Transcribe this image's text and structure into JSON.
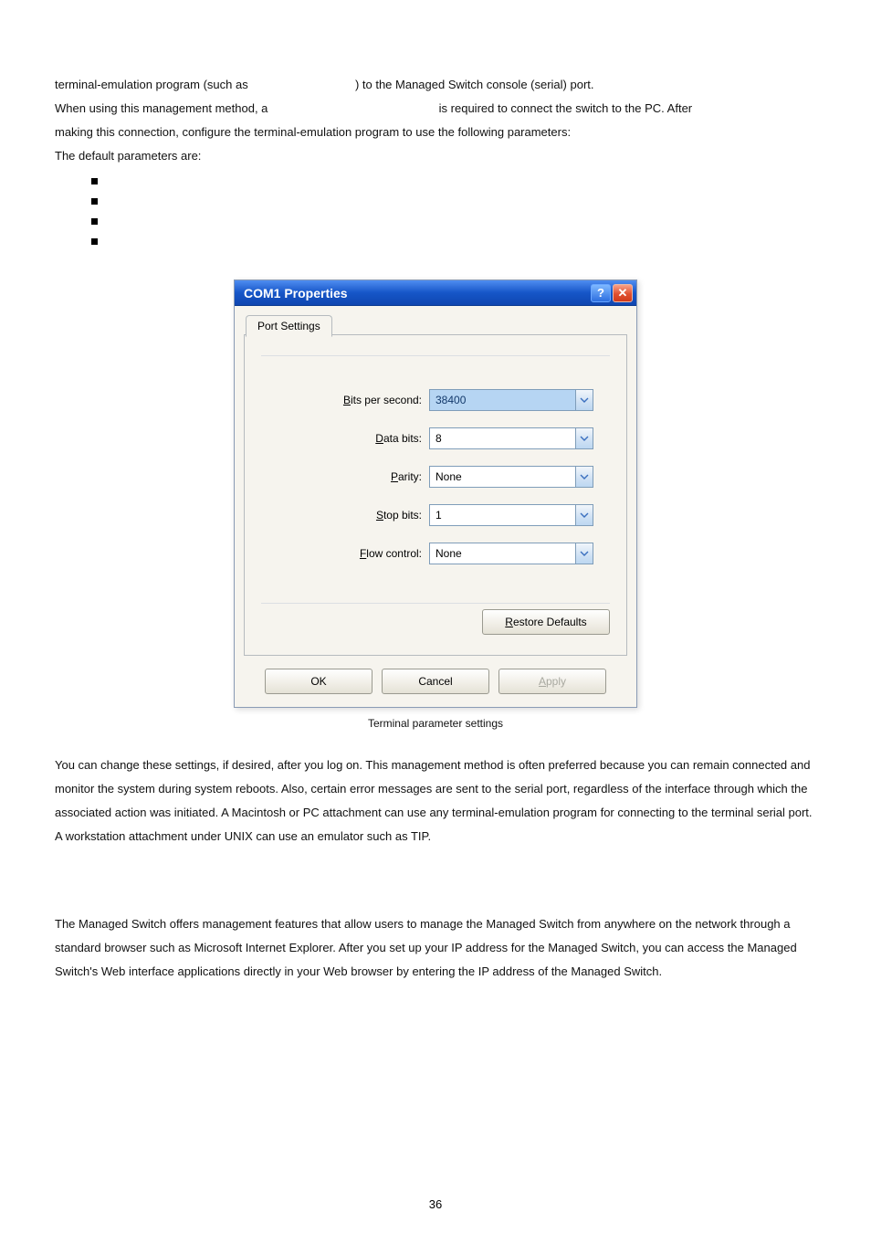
{
  "intro": {
    "line1_a": "terminal-emulation program (such as ",
    "line1_b": ") to the Managed Switch console (serial) port.",
    "line2_a": "When using this management method, a ",
    "line2_b": "is required to connect the switch to the PC. After",
    "line3": "making this connection, configure the terminal-emulation program to use the following parameters:",
    "line4": "The default parameters are:"
  },
  "dialog": {
    "title": "COM1 Properties",
    "help_symbol": "?",
    "close_symbol": "✕",
    "tab_label": "Port Settings",
    "fields": [
      {
        "label_head": "B",
        "label_rest": "its per second:",
        "value": "38400",
        "selected": true
      },
      {
        "label_head": "D",
        "label_rest": "ata bits:",
        "value": "8",
        "selected": false
      },
      {
        "label_head": "P",
        "label_rest": "arity:",
        "value": "None",
        "selected": false
      },
      {
        "label_head": "S",
        "label_rest": "top bits:",
        "value": "1",
        "selected": false
      },
      {
        "label_head": "F",
        "label_rest": "low control:",
        "value": "None",
        "selected": false
      }
    ],
    "restore_head": "R",
    "restore_rest": "estore Defaults",
    "ok": "OK",
    "cancel": "Cancel",
    "apply_head": "A",
    "apply_rest": "pply"
  },
  "caption": "Terminal parameter settings",
  "para2": "You can change these settings, if desired, after you log on. This management method is often preferred because you can remain connected and monitor the system during system reboots. Also, certain error messages are sent to the serial port, regardless of the interface through which the associated action was initiated. A Macintosh or PC attachment can use any terminal-emulation program for connecting to the terminal serial port. A workstation attachment under UNIX can use an emulator such as TIP.",
  "para3": "The Managed Switch offers management features that allow users to manage the Managed Switch from anywhere on the network through a standard browser such as Microsoft Internet Explorer. After you set up your IP address for the Managed Switch, you can access the Managed Switch's Web interface applications directly in your Web browser by entering the IP address of the Managed Switch.",
  "page_number": "36"
}
